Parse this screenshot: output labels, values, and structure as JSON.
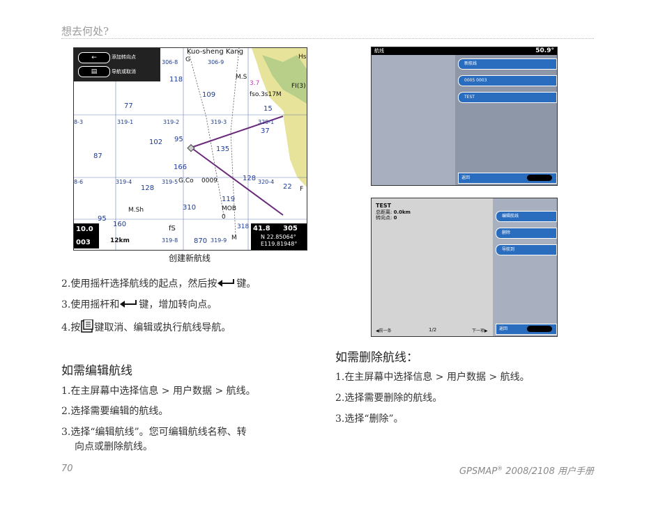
{
  "header": {
    "title": "想去何处?"
  },
  "map": {
    "menu": [
      "添加转向点",
      "导航或取消"
    ],
    "labels": [
      "Kuo-sheng Kang",
      "306-8",
      "306-9",
      "118",
      "M.S",
      "109",
      "77",
      "319-1",
      "319-2",
      "319-3",
      "320-1",
      "37",
      "8-3",
      "102",
      "95",
      "135",
      "87",
      "166",
      "8-6",
      "319-4",
      "128",
      "319-5",
      "G.Co",
      "0009",
      "128",
      "320-4",
      "22",
      "M.Sh",
      "310",
      "119",
      "MOB",
      "0",
      "95",
      "160",
      "fS",
      "318",
      "870",
      "319-9",
      "M",
      "319-8",
      "15",
      "3.7",
      "FI(3)",
      "fso.3s17M",
      "Hs",
      "G",
      "F"
    ],
    "scale_top": "10.0",
    "scale_bottom": "003",
    "scale_bar": "12km",
    "readout_top": "41.8",
    "readout_top2": "305",
    "readout_n": "N 22.85064°",
    "readout_e": "E119.81948°"
  },
  "caption": "创建新航线",
  "steps_create": [
    {
      "pre": "2.使用摇杆选择航线的起点，然后按",
      "post": "键。"
    },
    {
      "pre": "3.使用摇杆和",
      "post": "键，增加转向点。"
    },
    {
      "pre": "4.按",
      "post": "键取消、编辑或执行航线导航。"
    }
  ],
  "edit": {
    "title": "如需编辑航线",
    "steps": [
      "1.在主屏幕中选择信息 > 用户数据 > 航线。",
      "2.选择需要编辑的航线。",
      "3.选择“编辑航线”。您可编辑航线名称、转"
    ],
    "continuation": "向点或删除航线。"
  },
  "delete": {
    "title": "如需删除航线：",
    "steps": [
      "1.在主屏幕中选择信息 > 用户数据 > 航线。",
      "2.选择需要删除的航线。",
      "3.选择“删除”。"
    ]
  },
  "screen1": {
    "title": "航线",
    "value": "50.9",
    "unit": "°",
    "items": [
      "新航线",
      "0005 0003",
      "TEST"
    ],
    "back": "返回"
  },
  "screen2": {
    "name": "TEST",
    "dist_label": "总距离:",
    "dist_value": "0.0km",
    "turns_label": "转向点:",
    "turns_value": "0",
    "items": [
      "编辑航线",
      "删除",
      "导航到"
    ],
    "prev": "前一条",
    "page": "1/2",
    "next": "下一项",
    "back": "返回"
  },
  "footer": {
    "page": "70",
    "manual": "GPSMAP",
    "reg": "®",
    "manual_rest": " 2008/2108 用户手册"
  }
}
